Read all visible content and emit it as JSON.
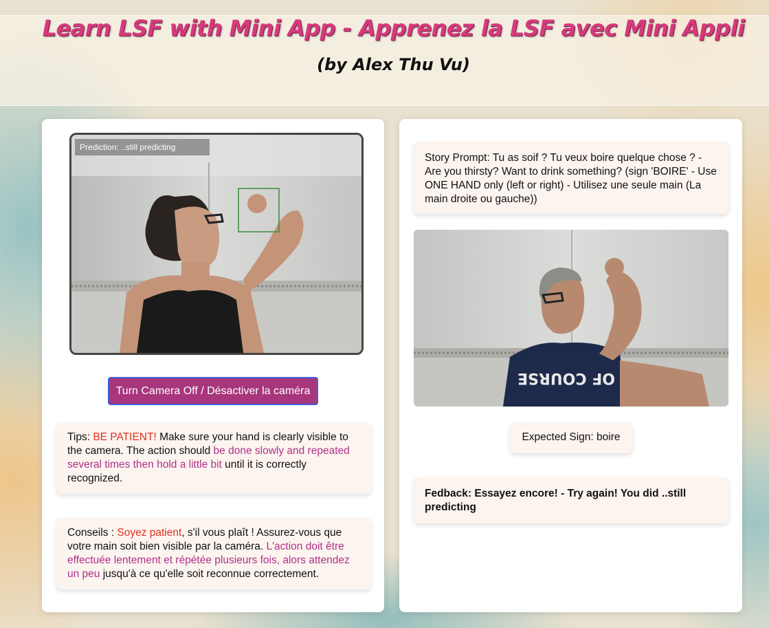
{
  "header": {
    "title": "Learn LSF with Mini App - Apprenez la LSF avec Mini Appli",
    "subtitle": "(by Alex Thu Vu)"
  },
  "camera": {
    "prediction": "Prediction: ..still predicting",
    "toggle_label": "Turn Camera Off / Désactiver la caméra"
  },
  "tips": {
    "prefix": "Tips: ",
    "highlight1": "BE PATIENT!",
    "middle": " Make sure your hand is clearly visible to the camera. The action should ",
    "highlight2": "be done slowly and repeated several times then hold a little bit",
    "suffix": " until it is correctly recognized."
  },
  "conseils": {
    "prefix": "Conseils : ",
    "highlight1": "Soyez patient",
    "middle": ", s'il vous plaît ! Assurez-vous que votre main soit bien visible par la caméra. ",
    "highlight2": "L'action doit être effectuée lentement et répétée plusieurs fois, alors attendez un peu",
    "suffix": " jusqu'à ce qu'elle soit reconnue correctement."
  },
  "story_prompt": "Story Prompt: Tu as soif ? Tu veux boire quelque chose ? - Are you thirsty? Want to drink something? (sign 'BOIRE' - Use ONE HAND only (left or right) - Utilisez une seule main (La main droite ou gauche))",
  "reference": {
    "shirt_text": "OF COURSE"
  },
  "expected_sign": "Expected Sign: boire",
  "feedback": "Fedback: Essayez encore! - Try again! You did ..still predicting",
  "colors": {
    "title": "#d63a7c",
    "button": "#a8367d",
    "button_border": "#3d5fd8",
    "highlight_red": "#e0301f",
    "highlight_pink": "#b0308a",
    "detection_box": "#3a8a3a"
  }
}
